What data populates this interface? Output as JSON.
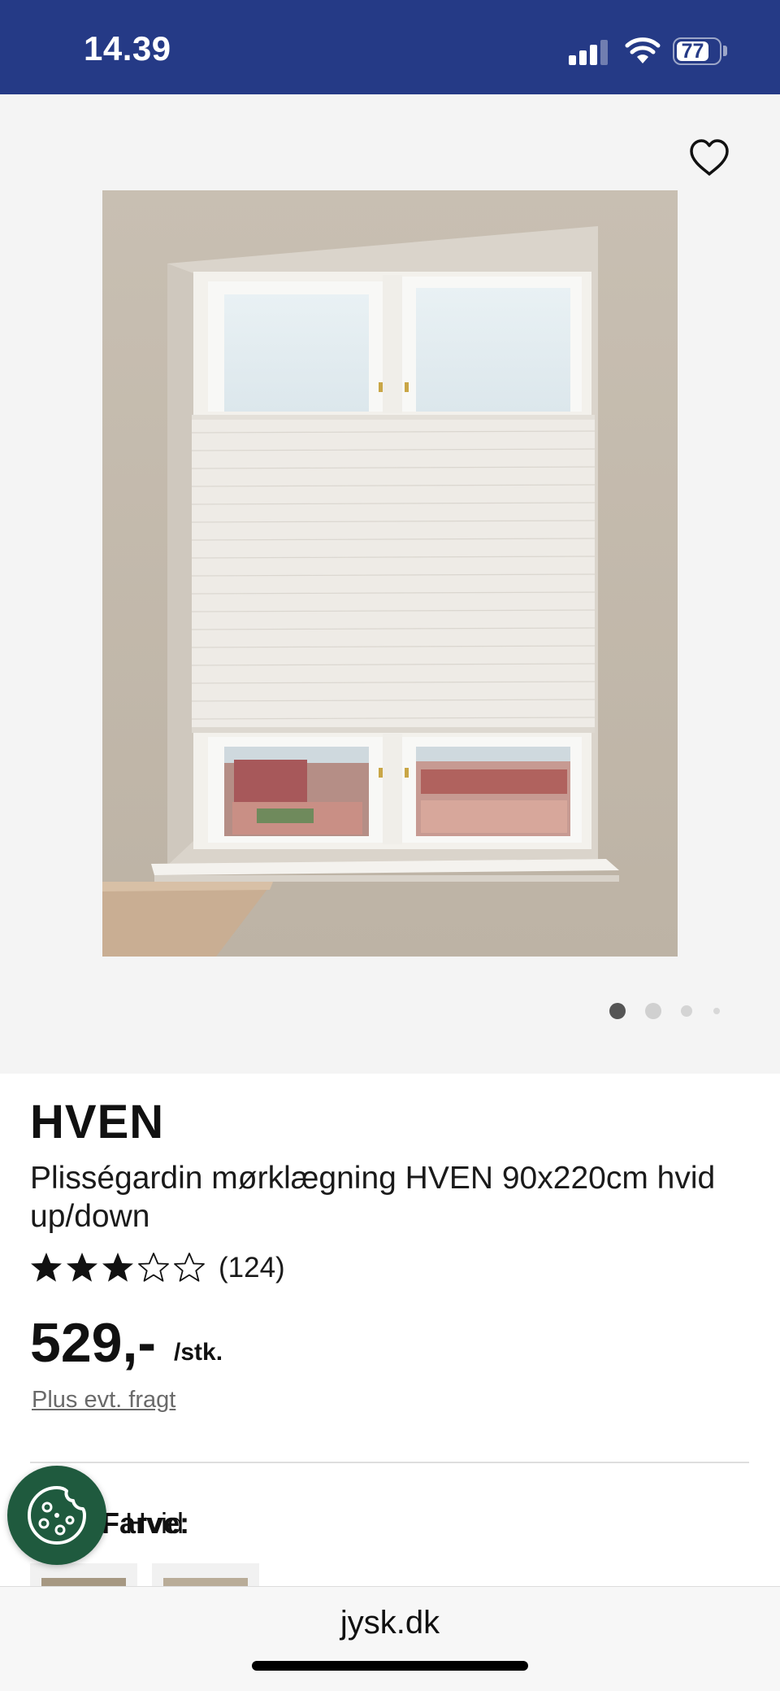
{
  "status_bar": {
    "time": "14.39",
    "battery": "77",
    "icons": [
      "signal-icon",
      "wifi-icon",
      "battery-icon"
    ]
  },
  "gallery": {
    "favorite_icon": "heart-outline-icon",
    "image_count": 4,
    "active_index": 0
  },
  "product": {
    "brand": "HVEN",
    "title": "Plisségardin mørklægning HVEN 90x220cm hvid up/down",
    "rating": 3,
    "rating_max": 5,
    "review_count": "(124)",
    "price": "529,-",
    "price_unit": "/stk.",
    "shipping_link": "Plus evt. fragt"
  },
  "variant": {
    "color_label": "Farve:",
    "color_value": "Hvid"
  },
  "cookie_button": {
    "icon": "cookie-icon",
    "color": "#1F5A3E"
  },
  "browser": {
    "url": "jysk.dk"
  },
  "colors": {
    "brand_blue": "#253A86",
    "gallery_bg": "#F4F4F4"
  }
}
